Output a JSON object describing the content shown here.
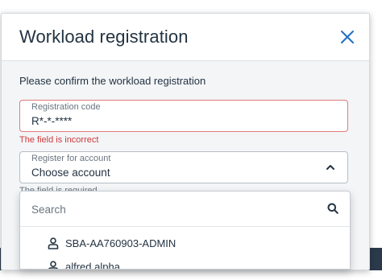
{
  "dialog": {
    "title": "Workload registration",
    "prompt": "Please confirm the workload registration"
  },
  "registration_code": {
    "label": "Registration code",
    "value": "R*-*-****",
    "error": "The field is incorrect"
  },
  "account": {
    "label": "Register for account",
    "selected": "Choose account",
    "error": "The field is required"
  },
  "dropdown": {
    "search_placeholder": "Search",
    "options": [
      {
        "label": "SBA-AA760903-ADMIN",
        "icon": "user-icon"
      },
      {
        "label": "alfred alpha",
        "icon": "user-icon"
      }
    ]
  },
  "colors": {
    "title": "#243342",
    "accent": "#1f6fc4",
    "error": "#d0393b",
    "error_border": "#e37b7b"
  }
}
